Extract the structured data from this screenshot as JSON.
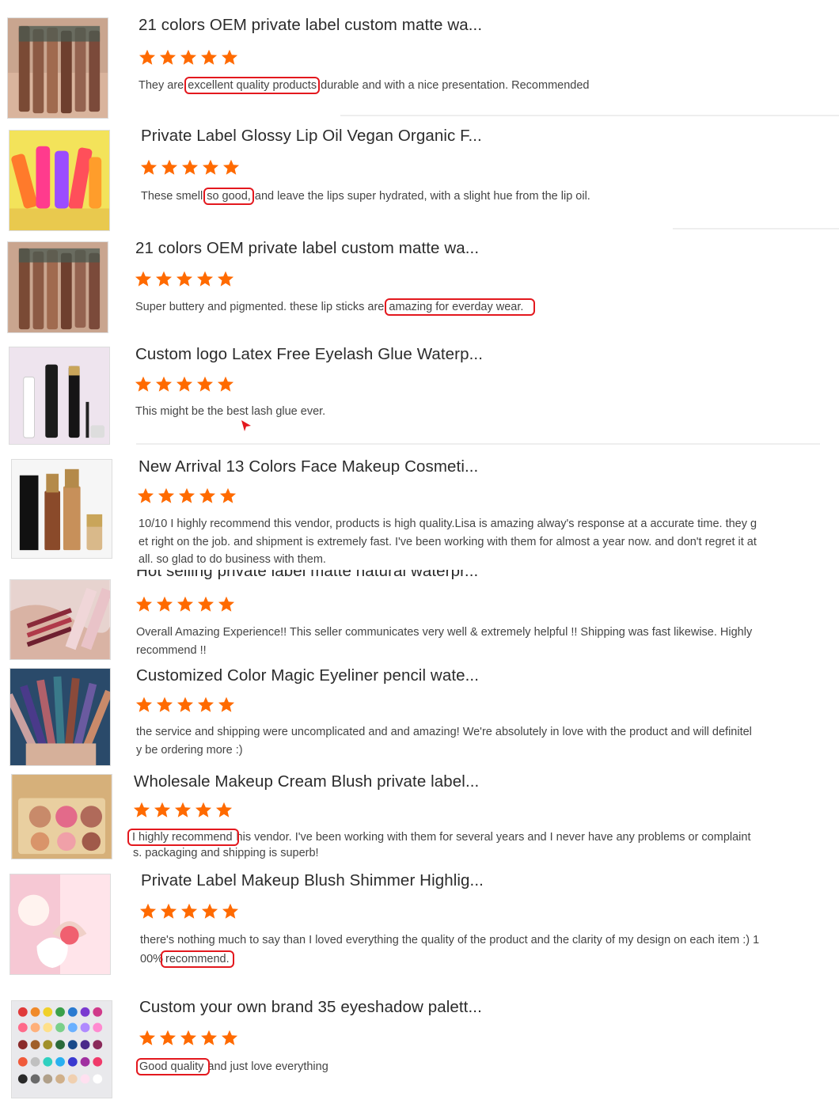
{
  "reviews": [
    {
      "title": "21 colors OEM private label custom matte wa...",
      "rating": 5,
      "text_pre": "They are",
      "text_hl": "excellent quality products",
      "text_post": "durable and with a nice presentation. Recommended",
      "thumb_icon": "lip-gloss-tubes-image"
    },
    {
      "title": "Private Label Glossy Lip Oil Vegan Organic F...",
      "rating": 5,
      "text_pre": "These smell",
      "text_hl": "so good,",
      "text_post": "and leave the lips super hydrated, with a slight hue from the lip oil.",
      "thumb_icon": "lip-oil-bottles-image"
    },
    {
      "title": "21 colors OEM private label custom matte wa...",
      "rating": 5,
      "text_pre": "Super buttery and pigmented. these lip sticks are",
      "text_hl": "amazing for everday wear.",
      "text_post": "",
      "thumb_icon": "lip-gloss-tubes-image"
    },
    {
      "title": "Custom logo Latex Free Eyelash Glue Waterp...",
      "rating": 5,
      "text": "This might be the best lash glue ever.",
      "thumb_icon": "lash-glue-tubes-image"
    },
    {
      "title": "New Arrival 13 Colors Face Makeup Cosmeti...",
      "rating": 5,
      "lines": [
        "10/10 I highly recommend this vendor, products is high quality.Lisa is amazing alway's response at a accurate time. they g",
        "et right on the job. and shipment is extremely fast. I've been working with them for almost a year now. and don't regret it at",
        "all. so glad to do business with them."
      ],
      "thumb_icon": "foundation-bottles-image"
    },
    {
      "title": "Hot selling private label matte natural waterpr...",
      "rating": 5,
      "lines": [
        "Overall Amazing Experience!! This seller communicates very well & extremely helpful !! Shipping was fast likewise. Highly",
        "recommend !!"
      ],
      "thumb_icon": "swatch-hand-image"
    },
    {
      "title": "Customized Color Magic Eyeliner pencil wate...",
      "rating": 5,
      "lines": [
        "the service and shipping were uncomplicated and and amazing! We're absolutely in love with the product and will definitel",
        "y be ordering more :)"
      ],
      "thumb_icon": "eyeliner-pencils-image"
    },
    {
      "title": "Wholesale Makeup Cream Blush private label...",
      "rating": 5,
      "text_hl": "I highly recommend",
      "text_post": "his vendor. I've been working with them for several years and I never have any problems or complaint",
      "line2": "s. packaging and shipping is superb!",
      "thumb_icon": "blush-palette-image"
    },
    {
      "title": "Private Label Makeup Blush Shimmer Highlig...",
      "rating": 5,
      "line1": "there's nothing much to say than I loved everything the quality of the product and the clarity of my design on each item :) 1",
      "line2_pre": "00%",
      "text_hl": "recommend.",
      "thumb_icon": "shell-highlighter-image"
    },
    {
      "title": "Custom your own brand 35 eyeshadow palett...",
      "rating": 5,
      "text_hl": "Good quality",
      "text_post": "and just love everything",
      "thumb_icon": "eyeshadow-palette-image"
    }
  ],
  "colors": {
    "star": "#ff6a00",
    "highlight_box": "#e3181e",
    "separator": "#eeeeee"
  }
}
